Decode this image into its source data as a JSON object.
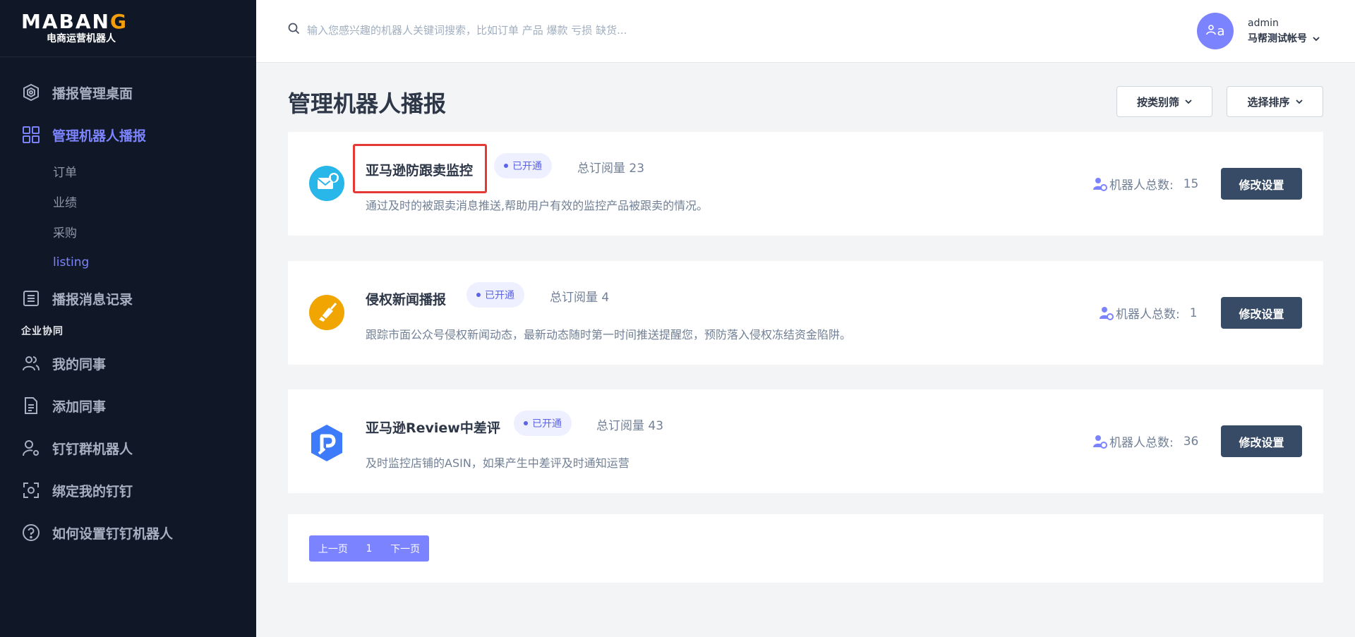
{
  "brand": {
    "logo_text_a": "MABAN",
    "logo_text_b": "G",
    "subtitle": "电商运营机器人"
  },
  "sidebar": {
    "items": [
      {
        "label": "播报管理桌面",
        "icon": "dashboard-icon"
      },
      {
        "label": "管理机器人播报",
        "icon": "grid-icon",
        "active": true
      },
      {
        "label": "播报消息记录",
        "icon": "list-icon"
      }
    ],
    "subitems": [
      {
        "label": "订单"
      },
      {
        "label": "业绩"
      },
      {
        "label": "采购"
      },
      {
        "label": "listing",
        "active": true
      }
    ],
    "section_title": "企业协同",
    "items2": [
      {
        "label": "我的同事",
        "icon": "users-icon"
      },
      {
        "label": "添加同事",
        "icon": "document-icon"
      },
      {
        "label": "钉钉群机器人",
        "icon": "user-gear-icon"
      },
      {
        "label": "绑定我的钉钉",
        "icon": "scan-icon"
      },
      {
        "label": "如何设置钉钉机器人",
        "icon": "help-icon"
      }
    ]
  },
  "search": {
    "placeholder": "输入您感兴趣的机器人关键词搜索，比如订单 产品 爆款 亏损 缺货..."
  },
  "user": {
    "avatar_text": "a",
    "name": "admin",
    "account": "马帮测试帐号"
  },
  "page": {
    "title": "管理机器人播报",
    "filter_category": "按类别筛",
    "filter_sort": "选择排序"
  },
  "cards": [
    {
      "title": "亚马逊防跟卖监控",
      "badge": "已开通",
      "subs": "总订阅量 23",
      "desc": "通过及时的被跟卖消息推送,帮助用户有效的监控产品被跟卖的情况。",
      "count_label": "机器人总数:",
      "count": "15",
      "edit": "修改设置",
      "icon": "mail-shield-icon"
    },
    {
      "title": "侵权新闻播报",
      "badge": "已开通",
      "subs": "总订阅量 4",
      "desc": "跟踪市面公众号侵权新闻动态，最新动态随时第一时间推送提醒您，预防落入侵权冻结资金陷阱。",
      "count_label": "机器人总数:",
      "count": "1",
      "edit": "修改设置",
      "icon": "broom-icon"
    },
    {
      "title": "亚马逊Review中差评",
      "badge": "已开通",
      "subs": "总订阅量 43",
      "desc": "及时监控店铺的ASIN，如果产生中差评及时通知运营",
      "count_label": "机器人总数:",
      "count": "36",
      "edit": "修改设置",
      "icon": "review-p-icon"
    }
  ],
  "pager": {
    "prev": "上一页",
    "current": "1",
    "next": "下一页"
  }
}
